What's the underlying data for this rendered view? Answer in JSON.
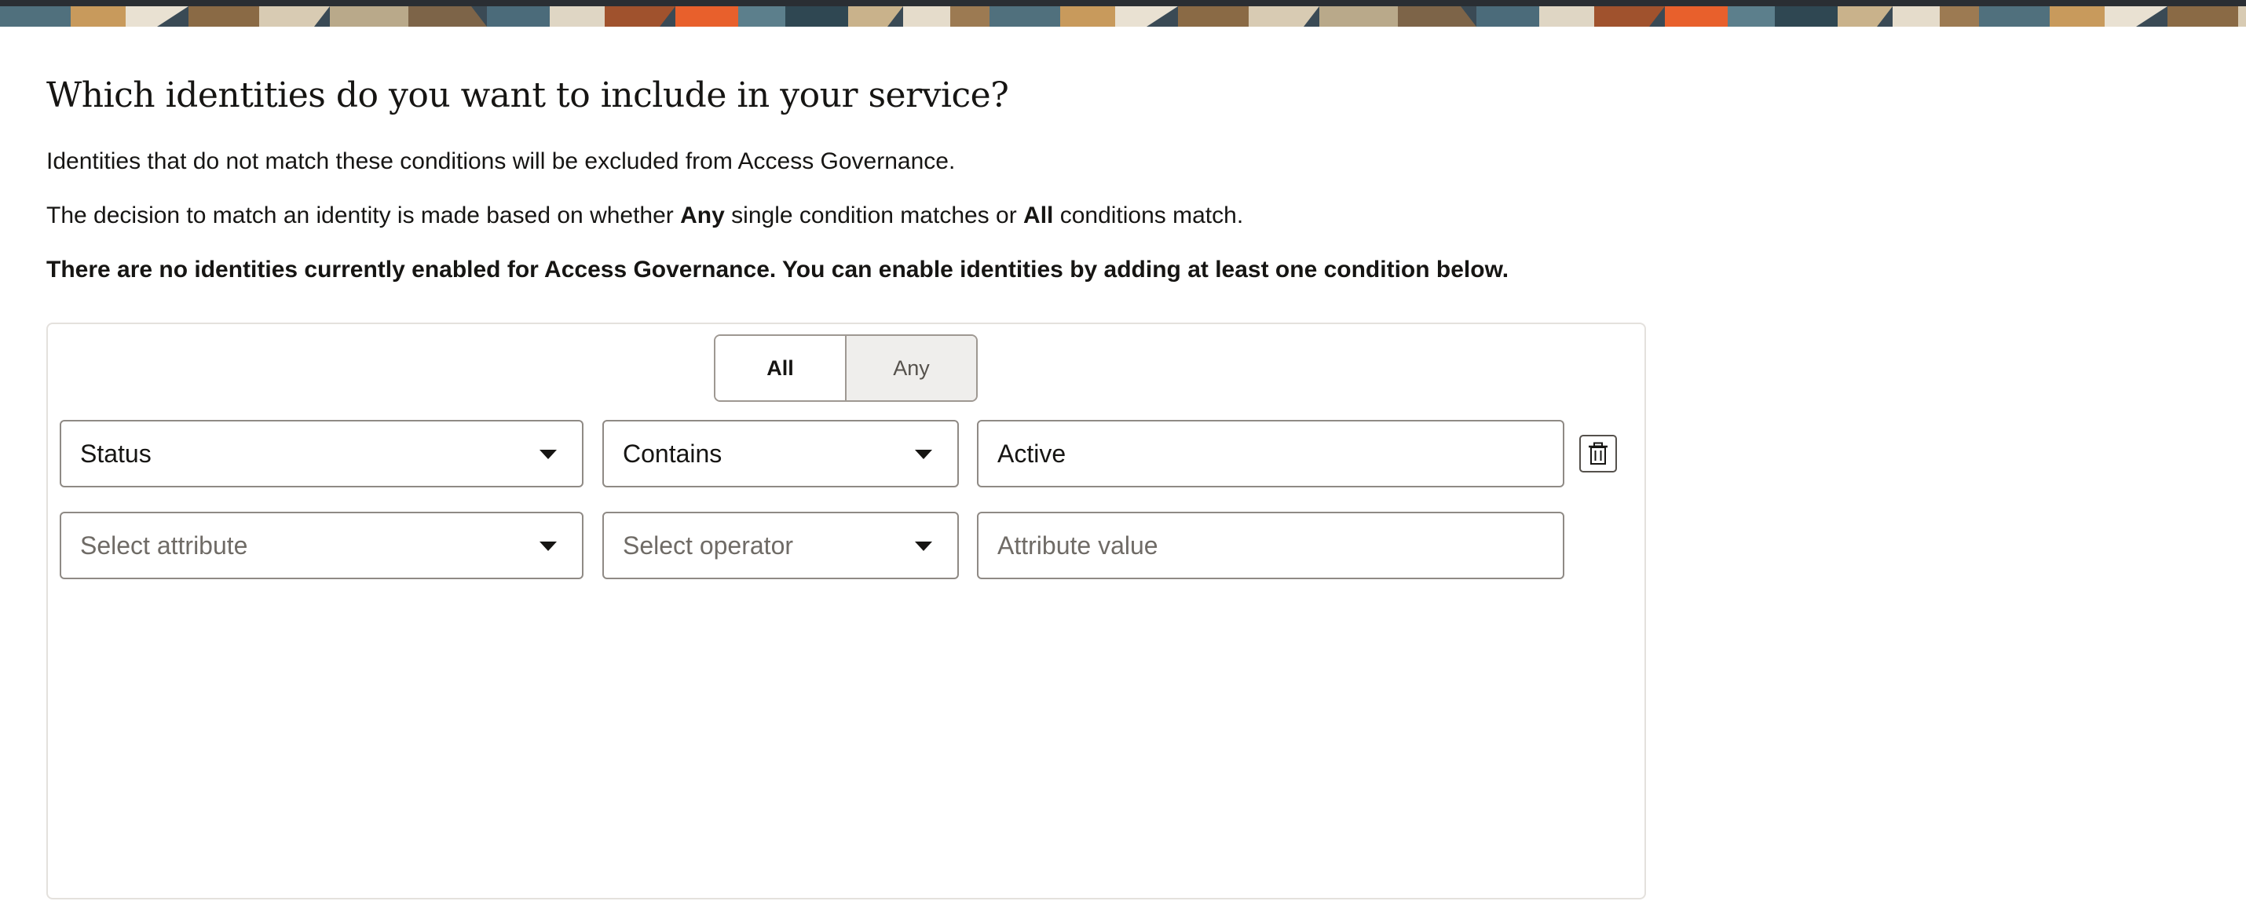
{
  "page": {
    "title": "Which identities do you want to include in your service?",
    "intro": "Identities that do not match these conditions will be excluded from Access Governance.",
    "decision": {
      "before": "The decision to match an identity is made based on whether ",
      "any": "Any",
      "middle": " single condition matches or ",
      "all": "All",
      "after": " conditions match."
    },
    "notice": "There are no identities currently enabled for Access Governance. You can enable identities by adding at least one condition below."
  },
  "match_toggle": {
    "options": [
      "All",
      "Any"
    ],
    "selected": "All"
  },
  "conditions": [
    {
      "attribute": "Status",
      "operator": "Contains",
      "value": "Active",
      "delete_icon": "trash-icon"
    },
    {
      "attribute_placeholder": "Select attribute",
      "operator_placeholder": "Select operator",
      "value_placeholder": "Attribute value"
    }
  ],
  "colors": {
    "text": "#161513",
    "border": "#8f8a85",
    "toggle_unselected_bg": "#efeeec",
    "panel_border": "#e4e1dd"
  }
}
